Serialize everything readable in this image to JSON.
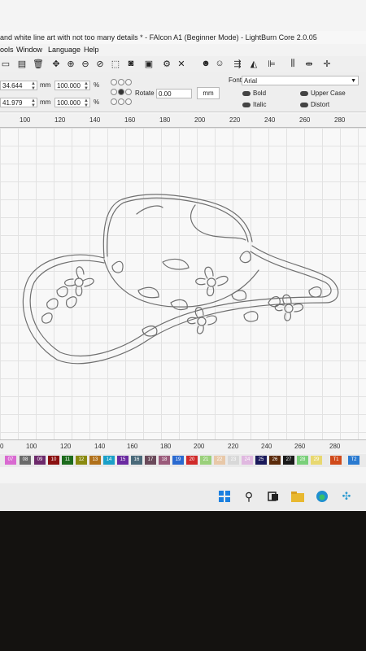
{
  "window": {
    "title": "and white line art with not too many details * - FAlcon A1 (Beginner Mode) - LightBurn Core 2.0.05"
  },
  "menu": [
    "ools",
    "Window",
    "Language",
    "Help"
  ],
  "toolbar_icons": [
    "new-file-icon",
    "save-icon",
    "trash-icon",
    "move-icon",
    "zoom-in-icon",
    "zoom-out-icon",
    "zoom-fit-icon",
    "frame-select-icon",
    "camera-icon",
    "monitor-icon",
    "settings-gear-icon",
    "wrench-icon",
    "users-icon",
    "user-icon",
    "send-icon",
    "mirror-icon",
    "align-icon",
    "distribute-icon",
    "center-icon"
  ],
  "props": {
    "x_value": "34.644",
    "y_value": "41.979",
    "mm": "mm",
    "w_value": "100.000",
    "h_value": "100.000",
    "percent": "%",
    "rotate_label": "Rotate",
    "rotate_value": "0.00",
    "unit_button": "mm",
    "font_label": "Font",
    "font_value": "Arial",
    "bold": "Bold",
    "italic": "Italic",
    "upper_case": "Upper Case",
    "distort": "Distort"
  },
  "ruler_top": [
    "100",
    "120",
    "140",
    "160",
    "180",
    "200",
    "220",
    "240",
    "260",
    "280"
  ],
  "ruler_bottom": [
    "0",
    "100",
    "120",
    "140",
    "160",
    "180",
    "200",
    "220",
    "240",
    "260",
    "280"
  ],
  "palette": [
    {
      "label": "07",
      "color": "#d96ad1"
    },
    {
      "label": "08",
      "color": "#6b6b6b"
    },
    {
      "label": "09",
      "color": "#6d2a6b"
    },
    {
      "label": "10",
      "color": "#8a1010"
    },
    {
      "label": "11",
      "color": "#1c6b1c"
    },
    {
      "label": "12",
      "color": "#8a8a10"
    },
    {
      "label": "13",
      "color": "#b0701a"
    },
    {
      "label": "14",
      "color": "#1aa0c8"
    },
    {
      "label": "15",
      "color": "#6a2aa0"
    },
    {
      "label": "16",
      "color": "#4a6a7a"
    },
    {
      "label": "17",
      "color": "#6a4a5a"
    },
    {
      "label": "18",
      "color": "#9a5a7a"
    },
    {
      "label": "19",
      "color": "#2a6ad0"
    },
    {
      "label": "20",
      "color": "#d02a2a"
    },
    {
      "label": "21",
      "color": "#9ad07a"
    },
    {
      "label": "22",
      "color": "#e8c8a8"
    },
    {
      "label": "23",
      "color": "#d8d8d8"
    },
    {
      "label": "24",
      "color": "#e0b8e0"
    },
    {
      "label": "25",
      "color": "#1a1a5a"
    },
    {
      "label": "26",
      "color": "#5a2a0a"
    },
    {
      "label": "27",
      "color": "#1a1a1a"
    },
    {
      "label": "28",
      "color": "#7ad07a"
    },
    {
      "label": "29",
      "color": "#e8d870"
    },
    {
      "label": "T1",
      "color": "#d04a1a"
    },
    {
      "label": "T2",
      "color": "#2a7ad0"
    }
  ],
  "taskbar_icons": [
    "windows-start-icon",
    "search-icon",
    "task-view-icon",
    "file-explorer-icon",
    "edge-browser-icon",
    "lightburn-app-icon"
  ]
}
